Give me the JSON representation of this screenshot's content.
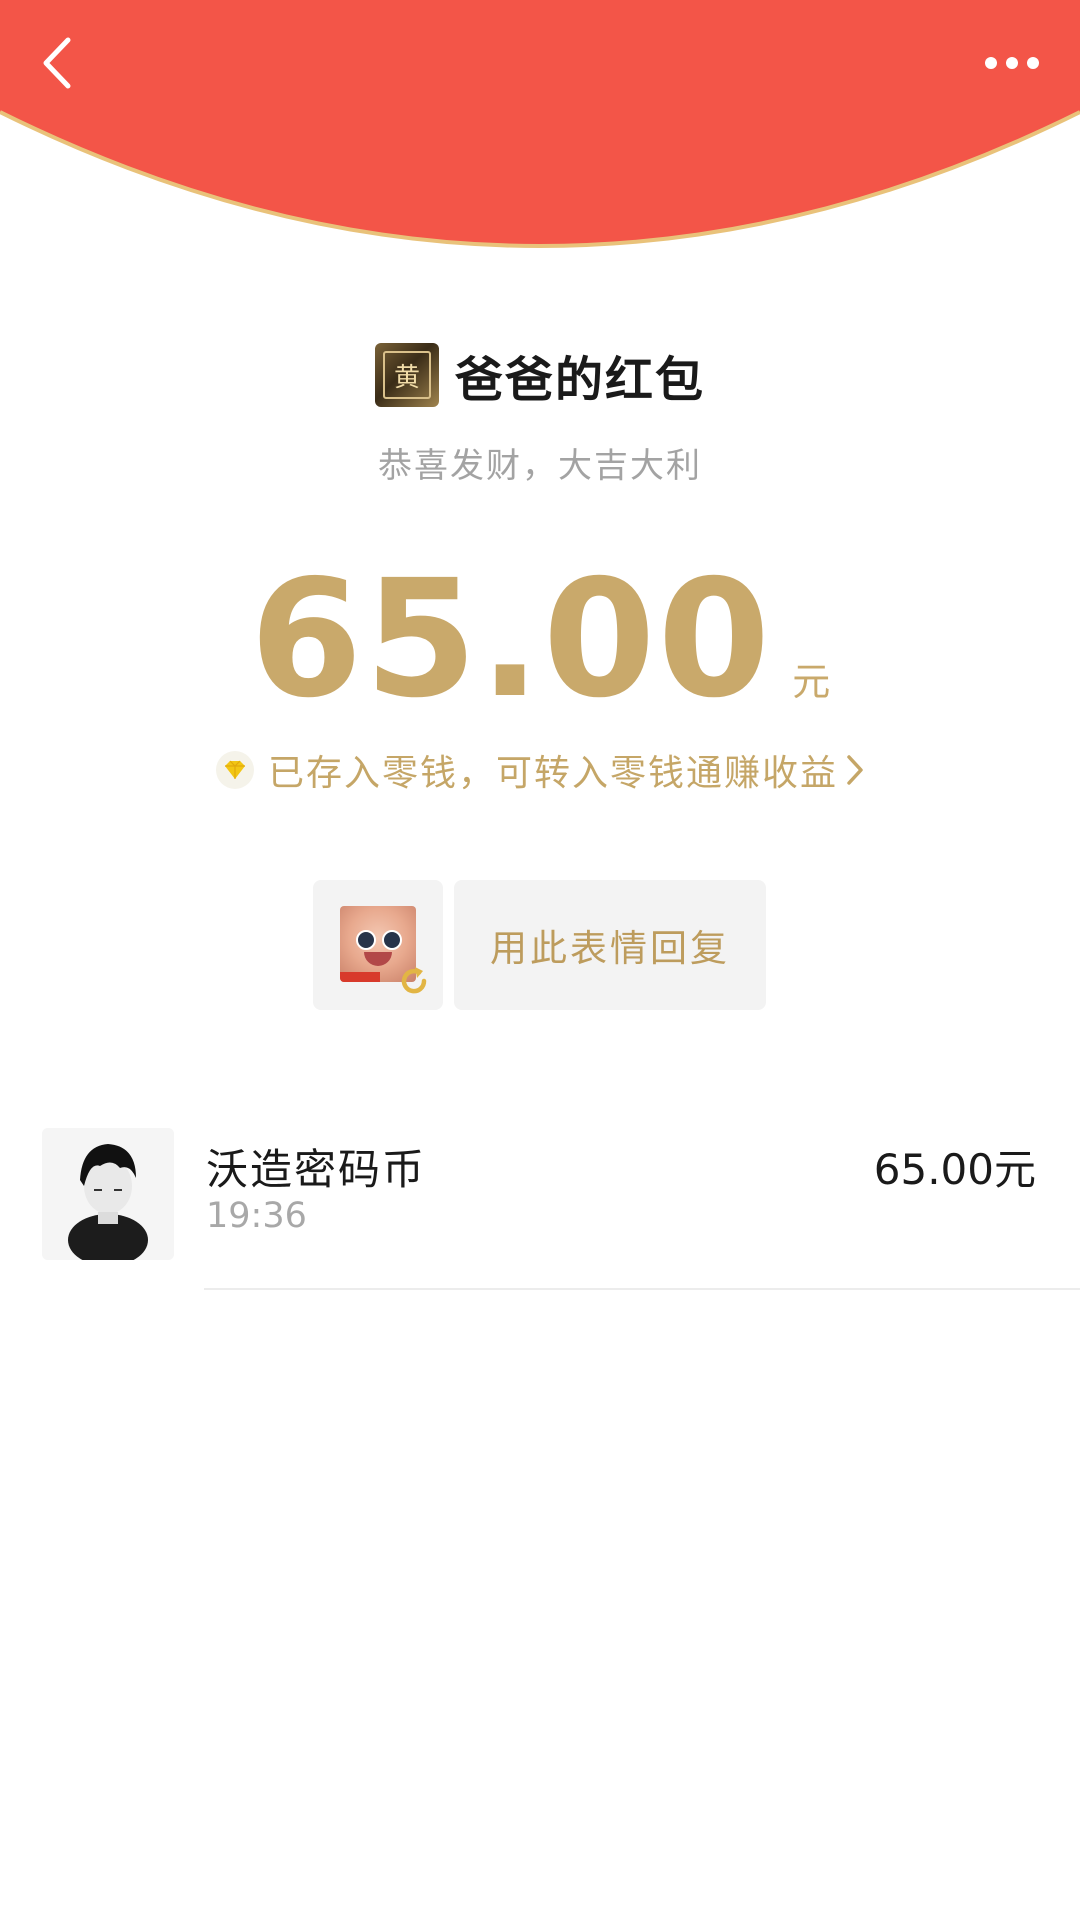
{
  "envelope": {
    "title": "爸爸的红包",
    "greeting": "恭喜发财，大吉大利",
    "sender_avatar_glyph": "黄",
    "amount": "65.00",
    "unit": "元"
  },
  "wallet_notice": {
    "text": "已存入零钱，可转入零钱通赚收益",
    "icon": "diamond-icon"
  },
  "sticker_reply": {
    "button_label": "用此表情回复"
  },
  "receiver": {
    "name": "沃造密码币",
    "time": "19:36",
    "amount": "65.00元"
  },
  "colors": {
    "header_red": "#f35548",
    "header_edge": "#e9c27a",
    "gold": "#c9a96b"
  }
}
